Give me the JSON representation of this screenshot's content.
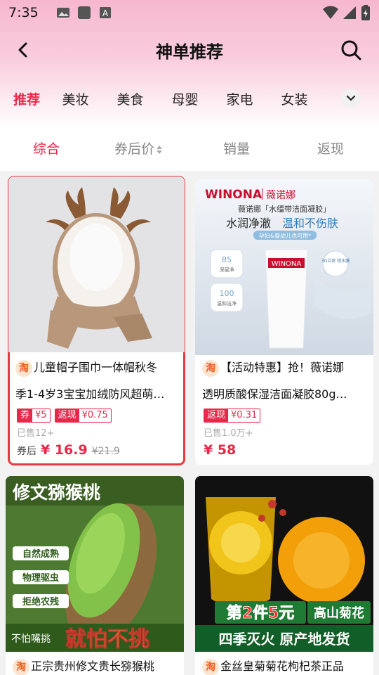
{
  "status_bar": {
    "time": "7:35"
  },
  "header": {
    "title": "神单推荐"
  },
  "categories": [
    "推荐",
    "美妆",
    "美食",
    "母婴",
    "家电",
    "女装"
  ],
  "sort_tabs": [
    "综合",
    "券后价",
    "销量",
    "返现"
  ],
  "products": [
    {
      "title": "儿童帽子围巾一体帽秋冬季1-4岁3宝宝加绒防风超萌…",
      "title_line1": "儿童帽子围巾一体帽秋冬",
      "title_line2": "季1-4岁3宝宝加绒防风超萌…",
      "platform_badge": "淘",
      "coupon_label": "券",
      "coupon_value": "¥5",
      "cashback_label": "返现",
      "cashback_value": "¥0.75",
      "sold": "已售12+",
      "price_label": "券后",
      "price": "¥ 16.9",
      "original_price": "¥21.9"
    },
    {
      "title": "【活动特惠】抢！薇诺娜透明质酸保湿洁面凝胶80g…",
      "title_line1": "【活动特惠】抢！薇诺娜",
      "title_line2": "透明质酸保湿洁面凝胶80g…",
      "platform_badge": "淘",
      "cashback_label": "返现",
      "cashback_value": "¥0.31",
      "sold": "已售1.0万+",
      "price": "¥ 58",
      "image_text": {
        "brand": "WINONA",
        "brand_cn": "薇诺娜",
        "product": "薇诺娜「水缰带洁面凝胶」",
        "slogan1": "水润净澈",
        "slogan2": "温和不伤肤",
        "sub": "孕妇&婴幼儿也可用*",
        "stat1": "85",
        "stat1_label": "深层净",
        "stat2": "100",
        "stat2_label": "温和洁净",
        "tube_brand": "WINONA",
        "badge": "3D立体 锁水膜"
      }
    },
    {
      "title": "正宗贵州修文贵长猕猴桃",
      "platform_badge": "淘",
      "image_text": {
        "headline": "修文猕猴桃",
        "bullets": [
          "自然成熟",
          "物理驱虫",
          "拒绝农残"
        ],
        "bottom_small": "不怕嘴挑",
        "bottom_big": "就怕不挑"
      }
    },
    {
      "title": "金丝皇菊菊花枸杞茶正品",
      "platform_badge": "淘",
      "image_text": {
        "promo": "第2件5元",
        "tag": "高山菊花",
        "bottom": "四季灭火 原产地发货"
      }
    }
  ],
  "colors": {
    "accent": "#e8284a",
    "selected_outline": "#e53a40"
  },
  "icons": [
    "back-arrow-icon",
    "search-icon",
    "chevron-down-icon",
    "sort-arrows-icon",
    "wifi-icon",
    "signal-icon",
    "battery-icon",
    "photo-icon",
    "app-icon",
    "text-icon"
  ]
}
